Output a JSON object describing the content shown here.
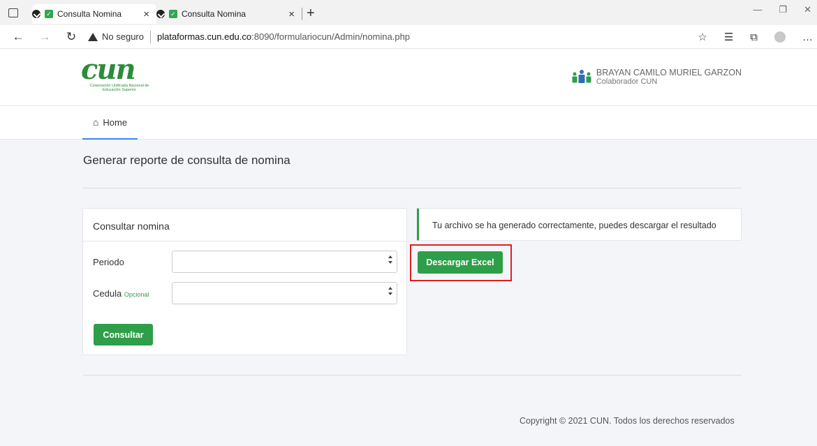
{
  "browser": {
    "tabs": [
      {
        "title": "Consulta Nomina",
        "active": true
      },
      {
        "title": "Consulta Nomina",
        "active": false
      }
    ],
    "new_tab_label": "+",
    "not_secure_label": "No seguro",
    "url_host": "plataformas.cun.edu.co",
    "url_path": ":8090/formulariocun/Admin/nomina.php"
  },
  "header": {
    "logo_mark": "cun",
    "logo_sub": "Corporación Unificada Nacional de Educación Superior",
    "user_name": "BRAYAN CAMILO MURIEL GARZON",
    "user_role": "Colaborador CUN"
  },
  "nav": {
    "home_label": "Home"
  },
  "main": {
    "page_title": "Generar reporte de consulta de nomina",
    "card": {
      "title": "Consultar nomina",
      "periodo_label": "Periodo",
      "cedula_label": "Cedula",
      "cedula_hint": "Opcional",
      "periodo_value": "",
      "cedula_value": "",
      "submit_label": "Consultar"
    },
    "alert_text": "Tu archivo se ha generado correctamente, puedes descargar el resultado",
    "download_label": "Descargar Excel"
  },
  "footer": {
    "copyright": "Copyright © 2021 CUN. Todos los derechos reservados"
  },
  "colors": {
    "brand_green": "#2e9e48",
    "highlight_red": "#e01e1e",
    "tab_accent": "#3b82f6"
  }
}
